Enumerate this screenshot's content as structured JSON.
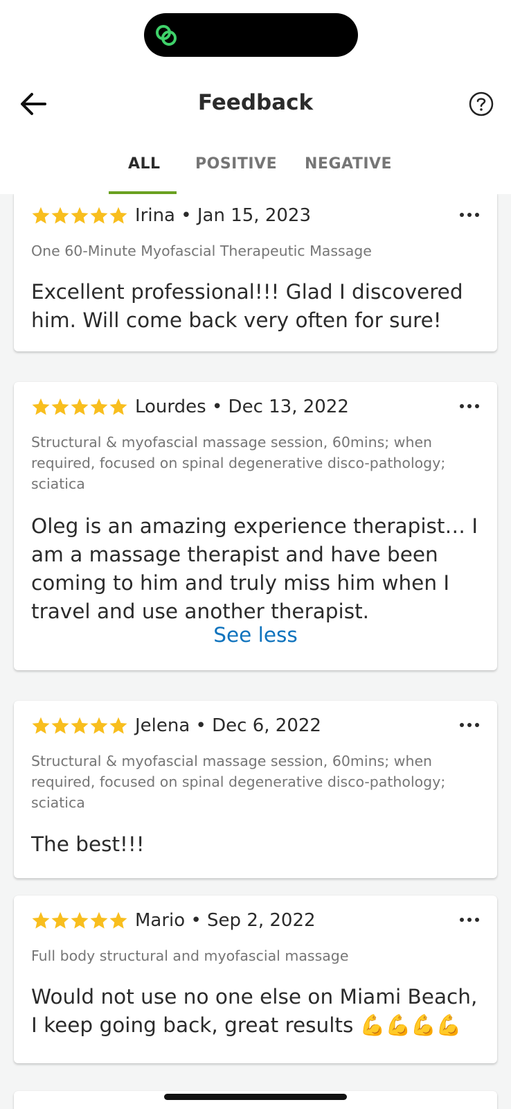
{
  "header": {
    "title": "Feedback"
  },
  "tabs": [
    {
      "label": "ALL"
    },
    {
      "label": "POSITIVE"
    },
    {
      "label": "NEGATIVE"
    }
  ],
  "reviews": [
    {
      "rating": 5,
      "author_line": "Irina • Jan 15, 2023",
      "service": "One 60-Minute Myofascial Therapeutic Massage",
      "text": "Excellent professional!!! Glad I discovered him. Will come back very often for sure!"
    },
    {
      "rating": 5,
      "author_line": "Lourdes • Dec 13, 2022",
      "service": "Structural & myofascial massage session, 60mins; when required, focused on spinal degenerative disco-pathology; sciatica",
      "text": "Oleg is an amazing experience therapist… I am a massage therapist and have been coming to him and truly miss him when I travel and use another therapist.",
      "toggle_label": "See less"
    },
    {
      "rating": 5,
      "author_line": "Jelena • Dec 6, 2022",
      "service": "Structural & myofascial massage session, 60mins; when required, focused on spinal degenerative disco-pathology; sciatica",
      "text": "The best!!!"
    },
    {
      "rating": 5,
      "author_line": "Mario • Sep 2, 2022",
      "service": "Full body structural and myofascial massage",
      "text": "Would not use no one else on Miami Beach, I keep going back, great results 💪💪💪💪"
    }
  ],
  "icons": {
    "island": "linked-rings-icon",
    "back": "arrow-left-icon",
    "help": "question-circle-icon",
    "star": "star-icon",
    "more": "more-horizontal-icon"
  },
  "colors": {
    "accent_green": "#6aa121",
    "star_yellow": "#f8be1e",
    "link_blue": "#0f73bd",
    "island_green": "#3fd16a"
  }
}
